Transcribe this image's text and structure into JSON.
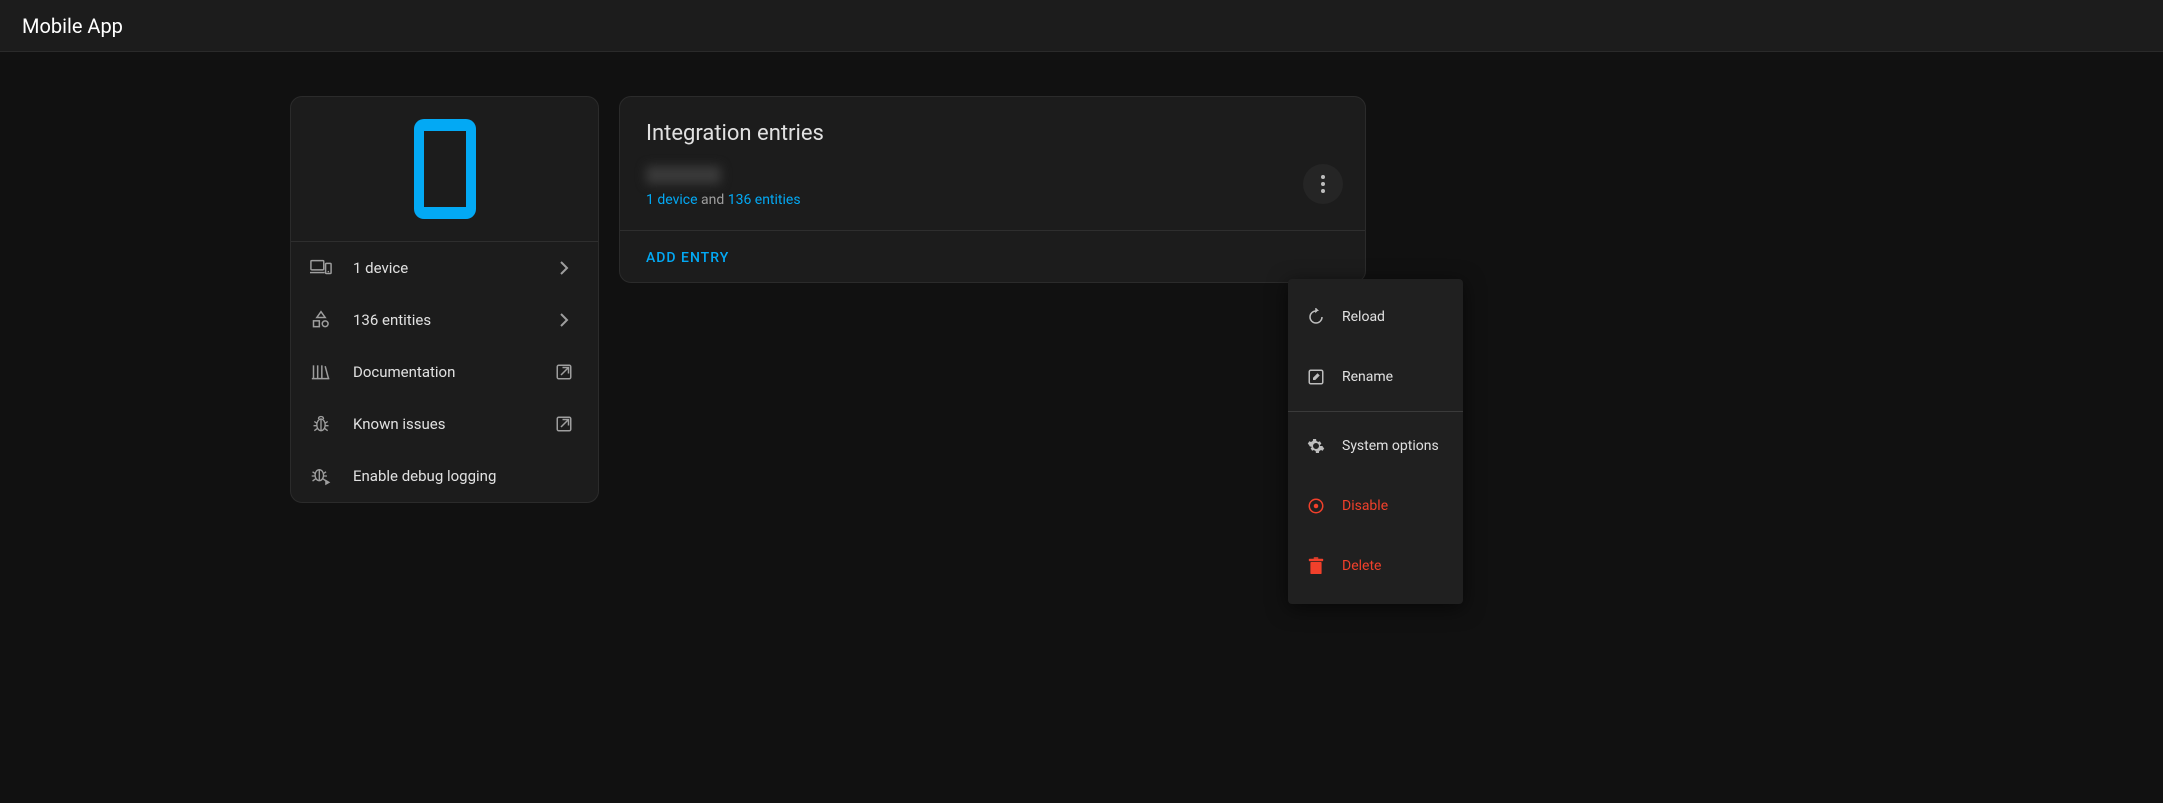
{
  "header": {
    "title": "Mobile App"
  },
  "sidebar": {
    "items": [
      {
        "label": "1 device"
      },
      {
        "label": "136 entities"
      },
      {
        "label": "Documentation"
      },
      {
        "label": "Known issues"
      },
      {
        "label": "Enable debug logging"
      }
    ]
  },
  "main": {
    "title": "Integration entries",
    "entry": {
      "devices_link": "1 device",
      "connector": " and ",
      "entities_link": "136 entities"
    },
    "add_entry_label": "ADD ENTRY"
  },
  "menu": {
    "reload": "Reload",
    "rename": "Rename",
    "system_options": "System options",
    "disable": "Disable",
    "delete": "Delete"
  }
}
